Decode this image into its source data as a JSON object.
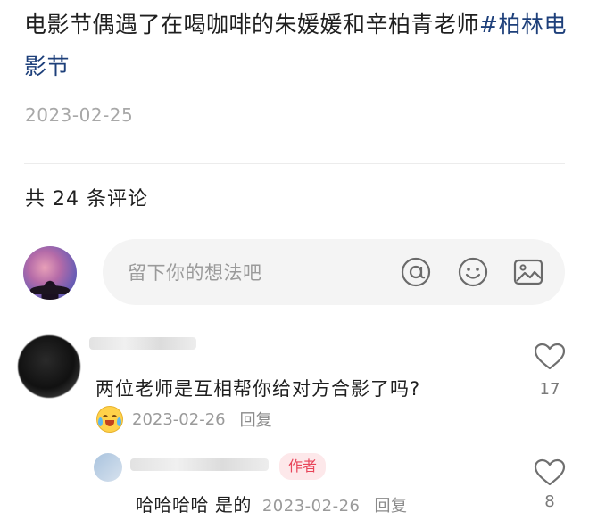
{
  "post": {
    "text": "电影节偶遇了在喝咖啡的朱媛媛和辛柏青老师",
    "hashtag": "#柏林电影节",
    "date": "2023-02-25"
  },
  "comments_header": "共 24 条评论",
  "input": {
    "placeholder": "留下你的想法吧"
  },
  "comment": {
    "text": "两位老师是互相帮你给对方合影了吗?",
    "date": "2023-02-26",
    "reply_label": "回复",
    "likes": "17"
  },
  "reply": {
    "badge": "作者",
    "text": "哈哈哈哈 是的",
    "date": "2023-02-26",
    "reply_label": "回复",
    "likes": "8"
  }
}
